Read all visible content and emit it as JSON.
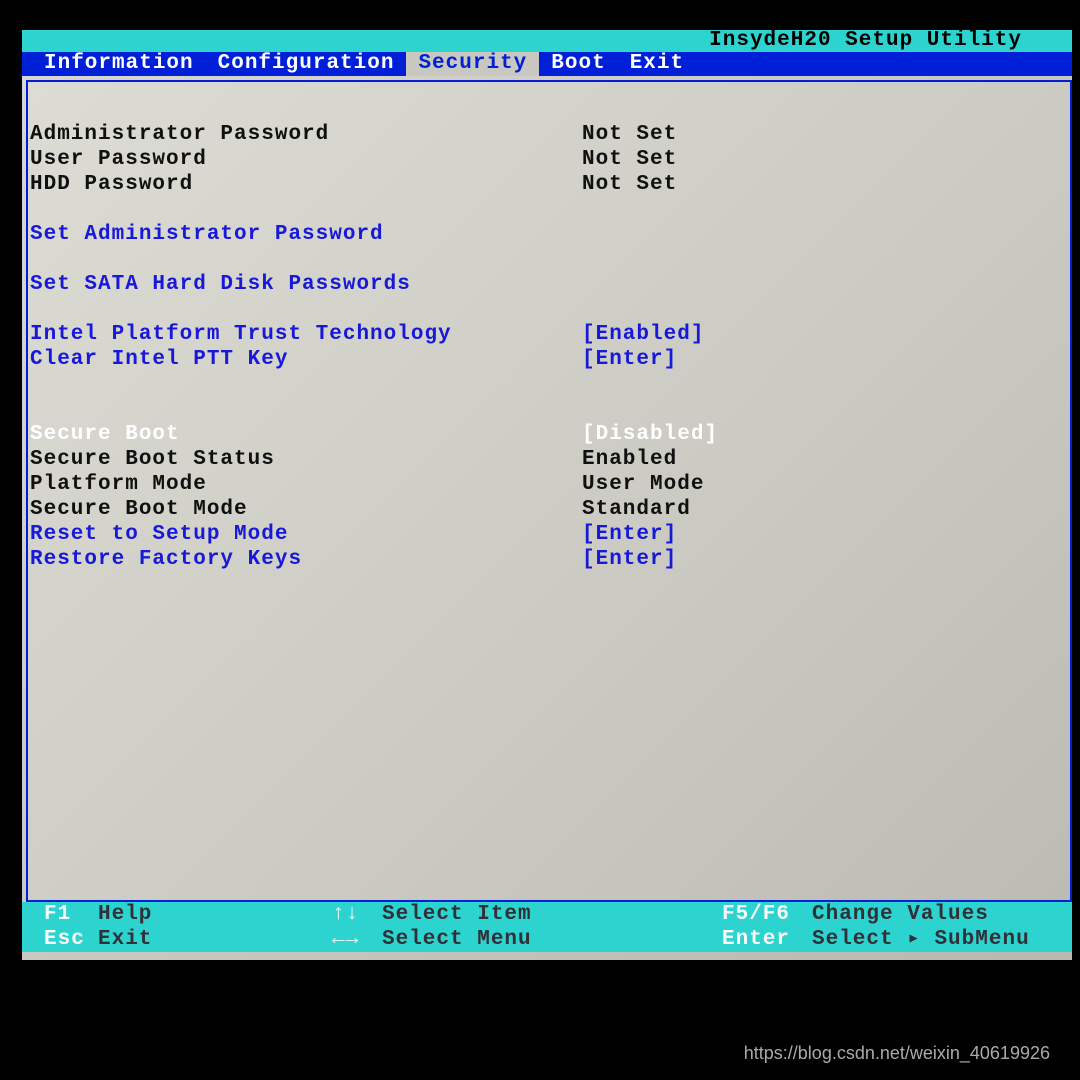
{
  "title": "InsydeH20 Setup Utility",
  "menu": {
    "items": [
      "Information",
      "Configuration",
      "Security",
      "Boot",
      "Exit"
    ],
    "active_index": 2
  },
  "rows": [
    {
      "label": "Administrator Password",
      "value": "Not Set",
      "lcls": "txt-black",
      "vcls": "txt-black",
      "interact": false
    },
    {
      "label": "User Password",
      "value": "Not Set",
      "lcls": "txt-black",
      "vcls": "txt-black",
      "interact": false
    },
    {
      "label": "HDD Password",
      "value": "Not Set",
      "lcls": "txt-black",
      "vcls": "txt-black",
      "interact": false
    },
    {
      "spacer": true
    },
    {
      "label": "Set Administrator Password",
      "value": "",
      "lcls": "txt-blue",
      "vcls": "txt-blue",
      "interact": true
    },
    {
      "spacer": true
    },
    {
      "label": "Set SATA Hard Disk Passwords",
      "value": "",
      "lcls": "txt-blue",
      "vcls": "txt-blue",
      "interact": true
    },
    {
      "spacer": true
    },
    {
      "label": "Intel Platform Trust Technology",
      "value": "[Enabled]",
      "lcls": "txt-blue",
      "vcls": "txt-blue",
      "interact": true
    },
    {
      "label": "Clear Intel PTT Key",
      "value": "[Enter]",
      "lcls": "txt-blue",
      "vcls": "txt-blue",
      "interact": true
    },
    {
      "spacer": true
    },
    {
      "spacer": true
    },
    {
      "label": "Secure Boot",
      "value": "[Disabled]",
      "lcls": "txt-white",
      "vcls": "txt-white",
      "interact": true,
      "selected": true
    },
    {
      "label": "Secure Boot Status",
      "value": "Enabled",
      "lcls": "txt-black",
      "vcls": "txt-black",
      "interact": false
    },
    {
      "label": "Platform Mode",
      "value": "User Mode",
      "lcls": "txt-black",
      "vcls": "txt-black",
      "interact": false
    },
    {
      "label": "Secure Boot Mode",
      "value": "Standard",
      "lcls": "txt-black",
      "vcls": "txt-black",
      "interact": false
    },
    {
      "label": "Reset to Setup Mode",
      "value": "[Enter]",
      "lcls": "txt-blue",
      "vcls": "txt-blue",
      "interact": true
    },
    {
      "label": "Restore Factory Keys",
      "value": "[Enter]",
      "lcls": "txt-blue",
      "vcls": "txt-blue",
      "interact": true
    }
  ],
  "footer": {
    "r1": {
      "k1": "F1",
      "l1": "Help",
      "k2": "↑↓",
      "l2": "Select Item",
      "k3": "F5/F6",
      "l3": "Change Values"
    },
    "r2": {
      "k1": "Esc",
      "l1": "Exit",
      "k2": "←→",
      "l2": "Select Menu",
      "k3": "Enter",
      "l3": "Select ▸ SubMenu"
    }
  },
  "watermark": "https://blog.csdn.net/weixin_40619926"
}
